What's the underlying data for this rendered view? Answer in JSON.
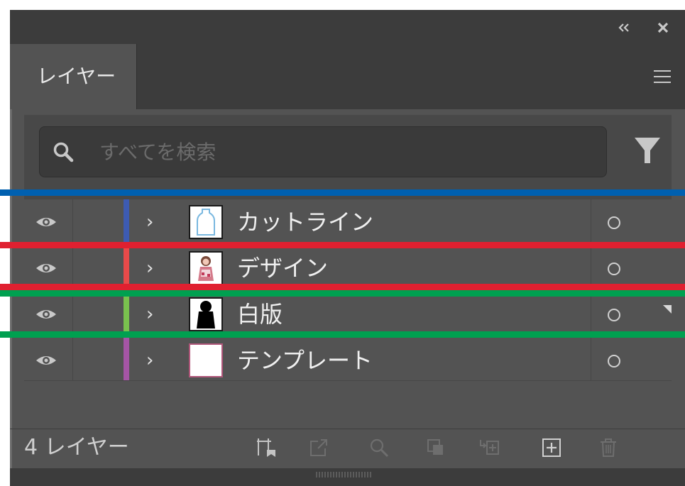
{
  "panel": {
    "tab_label": "レイヤー",
    "collapse_icon": "double-chevron-left-icon",
    "close_icon": "close-icon",
    "menu_icon": "hamburger-menu-icon"
  },
  "search": {
    "placeholder": "すべてを検索",
    "value": "",
    "icon": "search-icon",
    "filter_icon": "filter-icon"
  },
  "layers": [
    {
      "name": "カットライン",
      "color": "#3d5bb3",
      "thumbnail": "outline-bottle"
    },
    {
      "name": "デザイン",
      "color": "#e84a4a",
      "thumbnail": "character-art"
    },
    {
      "name": "白版",
      "color": "#79c14e",
      "thumbnail": "black-silhouette"
    },
    {
      "name": "テンプレート",
      "color": "#a555a5",
      "thumbnail": "blank-white"
    }
  ],
  "footer": {
    "count_label": "4 レイヤー",
    "icons": [
      "artboard-icon",
      "export-icon",
      "locate-object-icon",
      "clipping-mask-icon",
      "sublayer-icon",
      "new-layer-icon",
      "delete-icon"
    ]
  },
  "annotation_colors": [
    "#0060b0",
    "#e02030",
    "#e02030",
    "#00a050",
    "#00a050"
  ]
}
